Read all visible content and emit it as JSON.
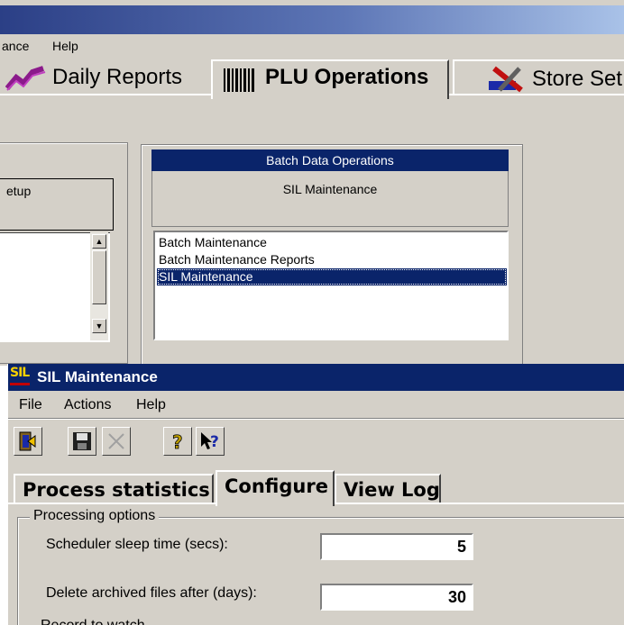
{
  "back_window": {
    "menu": [
      "ance",
      "Help"
    ],
    "tabs": [
      {
        "label": "Daily Reports",
        "icon": "chart-line-icon"
      },
      {
        "label": "PLU Operations",
        "icon": "barcode-icon",
        "active": true
      },
      {
        "label": "Store Set",
        "icon": "tools-icon"
      }
    ],
    "left_panel": {
      "header": "etup"
    },
    "batch_panel": {
      "title": "Batch Data Operations",
      "subtitle": "SIL Maintenance",
      "items": [
        "Batch Maintenance",
        "Batch Maintenance Reports",
        "SIL Maintenance"
      ],
      "selected_index": 2
    }
  },
  "sil_window": {
    "logo_text": "SIL",
    "title": "SIL Maintenance",
    "menu": [
      "File",
      "Actions",
      "Help"
    ],
    "toolbar": [
      {
        "icon": "exit-door-icon",
        "enabled": true
      },
      {
        "icon": "save-disk-icon",
        "enabled": true
      },
      {
        "icon": "delete-x-icon",
        "enabled": false
      },
      {
        "icon": "help-question-icon",
        "enabled": true
      },
      {
        "icon": "context-help-pointer-icon",
        "enabled": true
      }
    ],
    "tabs": [
      "Process statistics",
      "Configure",
      "View Log"
    ],
    "active_tab": "Configure",
    "processing_options": {
      "legend": "Processing options",
      "scheduler_label": "Scheduler sleep time (secs):",
      "scheduler_value": "5",
      "delete_label": "Delete archived files after (days):",
      "delete_value": "30",
      "partial_label": "Record to watch..."
    }
  },
  "colors": {
    "titlebar": "#0a246a",
    "face": "#d4d0c8",
    "selection": "#0a246a"
  }
}
